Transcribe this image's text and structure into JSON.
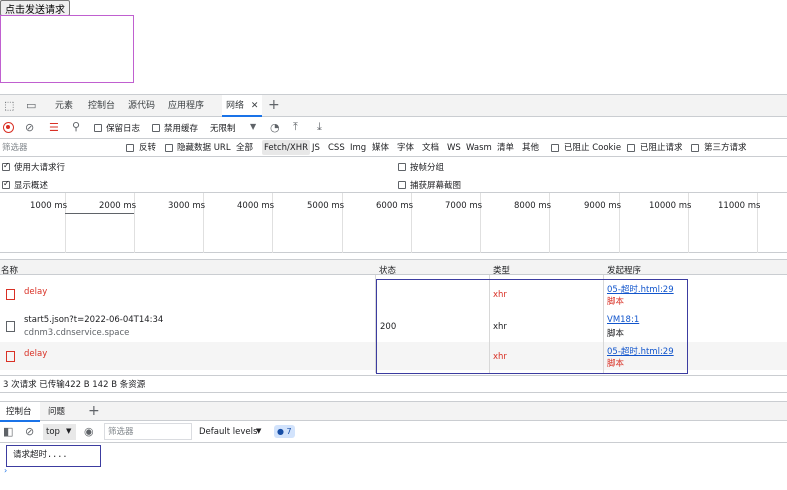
{
  "page": {
    "send_button": "点击发送请求"
  },
  "devtools": {
    "tabs": [
      "元素",
      "控制台",
      "源代码",
      "应用程序",
      "网络"
    ],
    "active_tab": "网络",
    "toolbar": {
      "preserve_log": "保留日志",
      "disable_cache": "禁用缓存",
      "throttle": "无限制"
    },
    "filter": {
      "placeholder": "筛选器",
      "invert": "反转",
      "hide_data_urls": "隐藏数据 URL",
      "all": "全部",
      "types": [
        "Fetch/XHR",
        "JS",
        "CSS",
        "Img",
        "媒体",
        "字体",
        "文档",
        "WS",
        "Wasm",
        "清单",
        "其他"
      ],
      "blocked_cookies": "已阻止 Cookie",
      "blocked_requests": "已阻止请求",
      "third_party": "第三方请求"
    },
    "options": {
      "big_rows": "使用大请求行",
      "overview": "显示概述",
      "group_by_frame": "按帧分组",
      "capture_screenshots": "捕获屏幕截图"
    },
    "timeline_labels": [
      "1000 ms",
      "2000 ms",
      "3000 ms",
      "4000 ms",
      "5000 ms",
      "6000 ms",
      "7000 ms",
      "8000 ms",
      "9000 ms",
      "10000 ms",
      "11000 ms"
    ],
    "columns": {
      "name": "名称",
      "status": "状态",
      "type": "类型",
      "initiator": "发起程序"
    },
    "requests": [
      {
        "name": "delay",
        "sub": "",
        "status": "",
        "type": "xhr",
        "initiator": "05-超时.html:29",
        "initiator_sub": "脚本",
        "error": true
      },
      {
        "name": "start5.json?t=2022-06-04T14:34",
        "sub": "cdnm3.cdnservice.space",
        "status": "200",
        "type": "xhr",
        "initiator": "VM18:1",
        "initiator_sub": "脚本",
        "error": false
      },
      {
        "name": "delay",
        "sub": "",
        "status": "",
        "type": "xhr",
        "initiator": "05-超时.html:29",
        "initiator_sub": "脚本",
        "error": true
      }
    ],
    "summary": "3 次请求  已传输422 B  142 B 条资源",
    "drawer": {
      "tabs": [
        "控制台",
        "问题"
      ],
      "context": "top",
      "filter_placeholder": "筛选器",
      "levels": "Default levels",
      "badge_count": "7",
      "message": "请求超时...."
    }
  }
}
